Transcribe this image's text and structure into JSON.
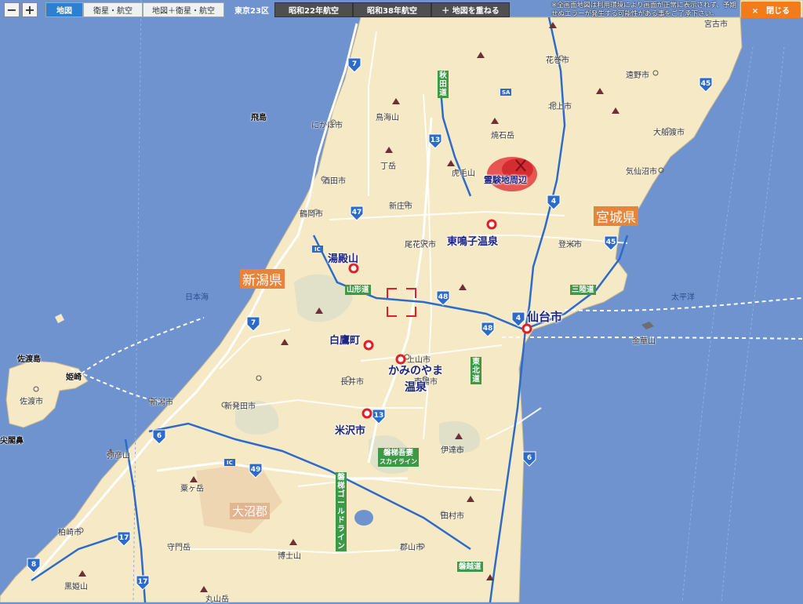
{
  "toolbar": {
    "zoom_out": "−",
    "zoom_in": "+",
    "modes": [
      "地図",
      "衛星・航空",
      "地図＋衛星・航空"
    ],
    "active_mode": "地図",
    "area_label": "東京23区",
    "aerial_1947": "昭和22年航空",
    "aerial_1963": "昭和38年航空",
    "overlay": "＋ 地図を重ねる",
    "close": "×　閉じる",
    "notice": "※全画面地図は利用環境により画面が正常に表示されず、予期せぬエラーが発生する可能性がある事をご了承下さい。"
  },
  "map": {
    "prefectures": [
      {
        "id": "niigata",
        "label": "新潟県",
        "color": "#e8833a"
      },
      {
        "id": "miyagi",
        "label": "宮城県",
        "color": "#e8833a"
      },
      {
        "id": "onuma",
        "label": "大沼郡",
        "color": "#e2b48f"
      }
    ],
    "places": [
      "花巻市",
      "遠野市",
      "北上市",
      "焼石岳",
      "大船渡市",
      "気仙沼市",
      "にかほ市",
      "鳥海山",
      "丁岳",
      "酒田市",
      "虎毛山",
      "新庄市",
      "鶴岡市",
      "尾花沢市",
      "登米市",
      "上山市",
      "長井市",
      "南陽市",
      "新発田市",
      "新潟市",
      "佐渡市",
      "弥彦山",
      "伊達市",
      "粟ヶ岳",
      "田村市",
      "柏崎市",
      "守門岳",
      "郡山市",
      "博士山",
      "黒姫山",
      "丸山岳",
      "金華山",
      "宮古市"
    ],
    "bold_places": [
      "飛島",
      "佐渡島",
      "姫崎",
      "尖閣鼻"
    ],
    "sea_labels": [
      "日本海",
      "太平洋"
    ],
    "pois": [
      {
        "id": "reiboku",
        "label": "霊験地周辺"
      },
      {
        "id": "higashi-naruko",
        "label": "東鳴子温泉"
      },
      {
        "id": "yudonosan",
        "label": "湯殿山"
      },
      {
        "id": "shirataka",
        "label": "白鷹町"
      },
      {
        "id": "kaminoyama",
        "label": "かみのやま\n温泉"
      },
      {
        "id": "yonezawa",
        "label": "米沢市"
      },
      {
        "id": "sendai",
        "label": "仙台市"
      }
    ],
    "routes": [
      "7",
      "13",
      "47",
      "48",
      "4",
      "45",
      "6",
      "49",
      "17",
      "8",
      "48"
    ],
    "road_names": [
      "秋田道",
      "山形道",
      "三陸道",
      "東北道",
      "磐梯吾妻",
      "スカイライン",
      "磐梯ゴールドライン",
      "磐越道"
    ],
    "ic_label": "IC",
    "sa_label": "SA",
    "colors": {
      "sea": "#6f93cf",
      "land": "#f6e9c5",
      "expressway": "#2c6bc9",
      "highway": "#ffffff",
      "poi_marker": "#e11f25"
    }
  }
}
